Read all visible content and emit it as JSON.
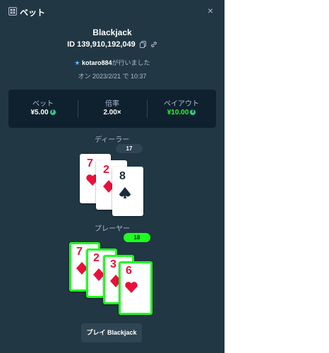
{
  "header": {
    "title": "ベット",
    "close_label": "×"
  },
  "game": {
    "name": "Blackjack",
    "id": "ID 139,910,192,049",
    "placed_by_user": "kotaro884",
    "placed_by_suffix": "が行いました",
    "date": "オン 2023/2/21 で 10:37"
  },
  "stats": {
    "bet": {
      "label": "ベット",
      "value": "¥5.00"
    },
    "multiplier": {
      "label": "倍率",
      "value": "2.00×"
    },
    "payout": {
      "label": "ペイアウト",
      "value": "¥10.00"
    }
  },
  "dealer": {
    "label": "ディーラー",
    "total": "17",
    "cards": [
      {
        "rank": "7",
        "suit": "heart",
        "color": "#e9113c"
      },
      {
        "rank": "2",
        "suit": "diamond",
        "color": "#e9113c"
      },
      {
        "rank": "8",
        "suit": "spade",
        "color": "#1a2c38"
      }
    ]
  },
  "player": {
    "label": "プレーヤー",
    "total": "18",
    "cards": [
      {
        "rank": "7",
        "suit": "diamond",
        "color": "#e9113c"
      },
      {
        "rank": "2",
        "suit": "diamond",
        "color": "#e9113c"
      },
      {
        "rank": "3",
        "suit": "diamond",
        "color": "#e9113c"
      },
      {
        "rank": "6",
        "suit": "heart",
        "color": "#e9113c"
      }
    ]
  },
  "play_button": {
    "label": "プレイ Blackjack"
  },
  "colors": {
    "panel": "#213743",
    "stats_bg": "#0f212e",
    "accent_green": "#1fff20",
    "card_red": "#e9113c",
    "card_black": "#1a2c38"
  }
}
